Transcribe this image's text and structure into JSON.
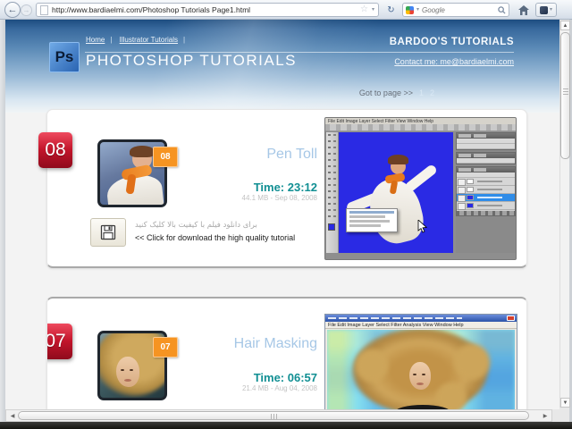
{
  "browser": {
    "url": "http://www.bardiaelmi.com/Photoshop Tutorials Page1.html",
    "search": {
      "placeholder": "Google"
    }
  },
  "header": {
    "logo": "Ps",
    "nav": {
      "home": "Home",
      "illustrator": "Illustrator Tutorials",
      "separator": "|"
    },
    "site_title": "BARDOO'S TUTORIALS",
    "page_title": "PHOTOSHOP TUTORIALS",
    "contact": "Contact me: me@bardiaelmi.com",
    "pagination": {
      "label": "Got to page >>",
      "pages": [
        "1",
        "2"
      ]
    }
  },
  "tutorials": [
    {
      "number": "08",
      "title": "Pen Toll",
      "time_label": "Time:",
      "time": "23:12",
      "meta": "44.1 MB  -  Sep 08, 2008",
      "persian_note": "برای دانلود فیلم با کیفیت بالا کلیک کنید",
      "download_text": "<< Click for download the high quality tutorial",
      "ps_menu": "File Edit Image Layer Select Filter View Window Help"
    },
    {
      "number": "07",
      "title": "Hair Masking",
      "time_label": "Time:",
      "time": "06:57",
      "meta": "21.4 MB  -  Aug 04, 2008",
      "ps_menu": "File Edit Image Layer Select Filter Analysis View Window Help"
    }
  ],
  "colors": {
    "red_badge": "#c3152b",
    "orange_badge": "#f69422",
    "time_teal": "#118f93",
    "title_blue": "#a6c7e6",
    "canvas_blue": "#2a2ae4"
  }
}
